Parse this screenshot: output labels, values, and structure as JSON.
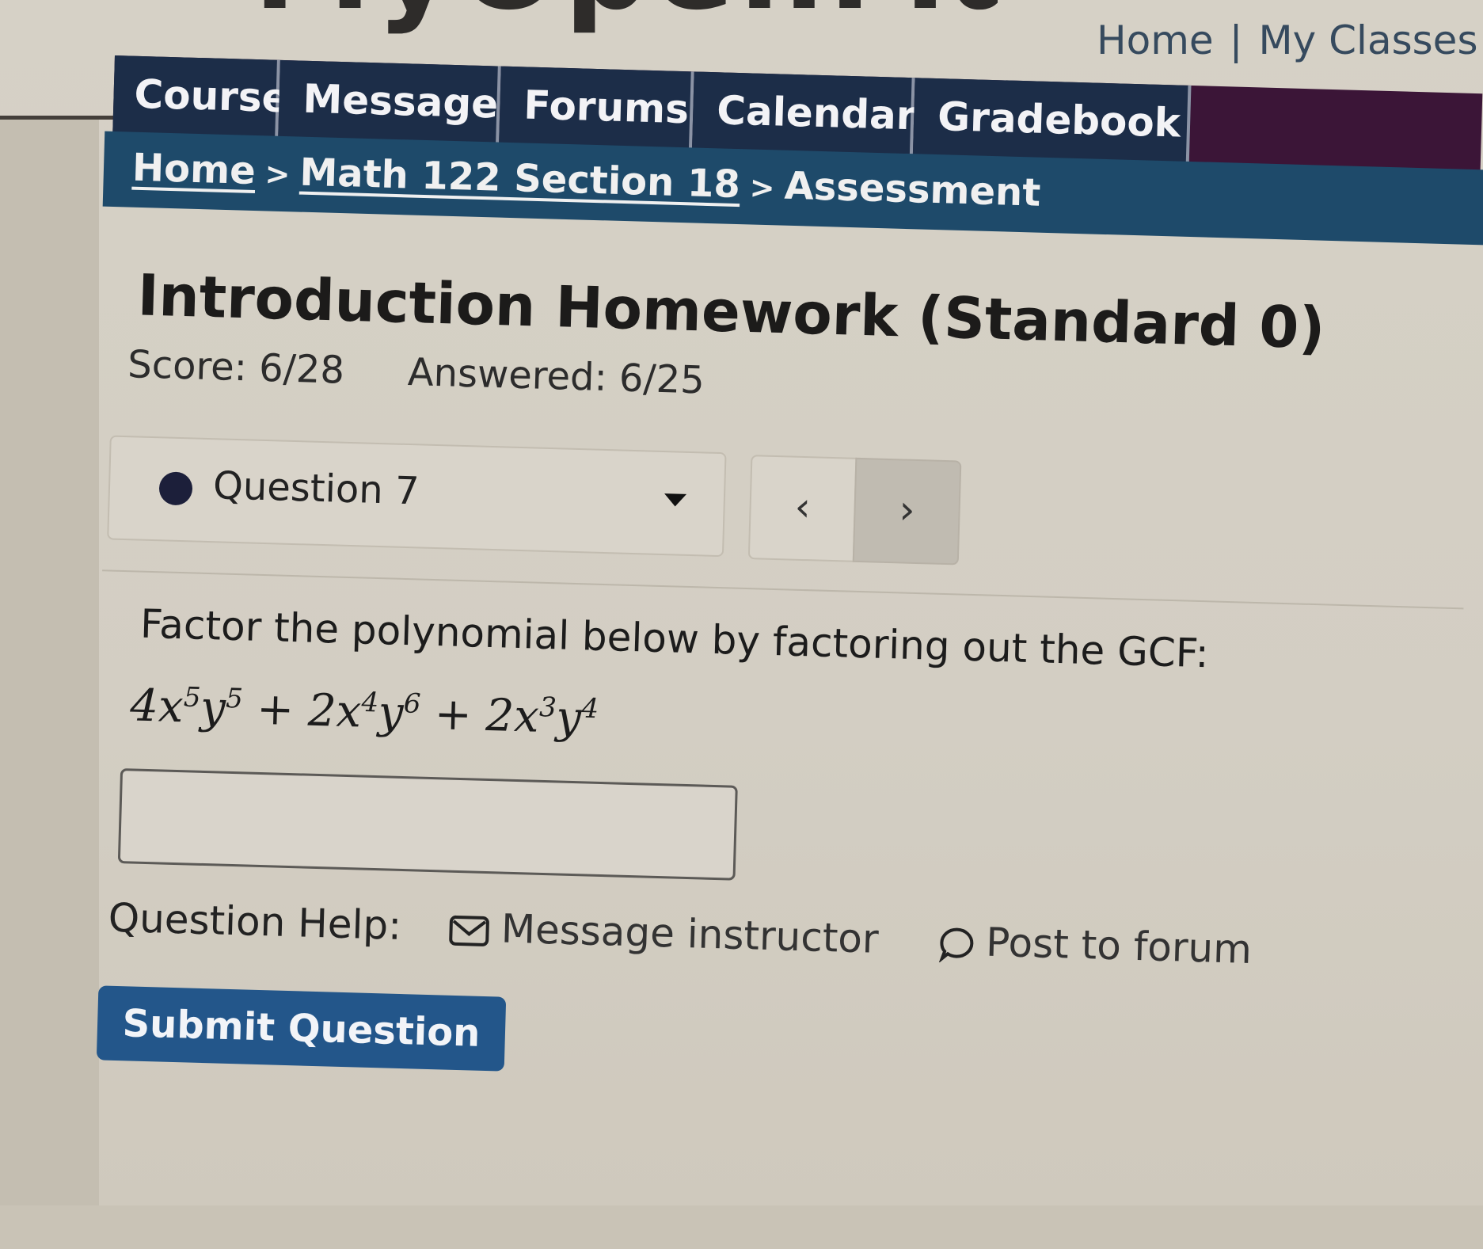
{
  "app": {
    "logo_text": "MyOpenMath",
    "top_links": {
      "home": "Home",
      "separator": "|",
      "classes": "My Classes"
    }
  },
  "nav": {
    "tabs": [
      "Course",
      "Messages",
      "Forums",
      "Calendar",
      "Gradebook"
    ],
    "breadcrumb": {
      "home": "Home",
      "course": "Math 122 Section 18",
      "current": "Assessment",
      "separator": ">"
    }
  },
  "assessment": {
    "title": "Introduction Homework (Standard 0)",
    "score": "Score: 6/28",
    "answered": "Answered: 6/25"
  },
  "question_nav": {
    "current": "Question 7",
    "prev_symbol": "‹",
    "next_symbol": "›"
  },
  "question": {
    "prompt": "Factor the polynomial below by factoring out the GCF:",
    "terms": [
      {
        "coef": "4",
        "x_exp": "5",
        "y_exp": "5"
      },
      {
        "coef": "2",
        "x_exp": "4",
        "y_exp": "6"
      },
      {
        "coef": "2",
        "x_exp": "3",
        "y_exp": "4"
      }
    ],
    "operator": "+",
    "answer_value": ""
  },
  "help": {
    "label": "Question Help:",
    "message": "Message instructor",
    "forum": "Post to forum"
  },
  "submit_label": "Submit Question",
  "colors": {
    "nav": "#1c2d48",
    "breadcrumb": "#1e4a6a",
    "accent": "#23568a",
    "navbar_tail": "#3b1537"
  }
}
